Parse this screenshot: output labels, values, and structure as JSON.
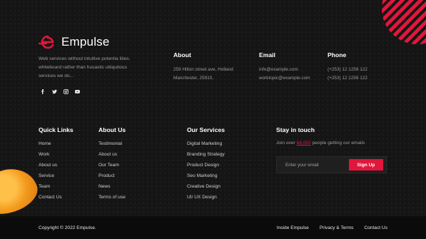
{
  "brand": {
    "name": "Empulse",
    "description": "Web services without intuitive potentia lities. whiteboard rather than husastic ubiquitous services we do...",
    "accent_color": "#e2163b"
  },
  "socials": [
    {
      "icon": "facebook-icon"
    },
    {
      "icon": "twitter-icon"
    },
    {
      "icon": "instagram-icon"
    },
    {
      "icon": "youtube-icon"
    }
  ],
  "about": {
    "title": "About",
    "line1": "259 Hilton street ave, Holland",
    "line2": "Manchester, 25910,"
  },
  "email": {
    "title": "Email",
    "line1": "info@example.com",
    "line2": "worktopic@example.com"
  },
  "phone": {
    "title": "Phone",
    "line1": "(+253) 12 1256 122",
    "line2": "(+253) 12 1256 122"
  },
  "quick_links": {
    "title": "Quick Links",
    "items": [
      "Home",
      "Work",
      "About us",
      "Service",
      "Team",
      "Contact Us"
    ]
  },
  "about_us": {
    "title": "About Us",
    "items": [
      "Testimonial",
      "About us",
      "Our Team",
      "Product",
      "News",
      "Terms of use"
    ]
  },
  "services": {
    "title": "Our Services",
    "items": [
      "Digital Marketing",
      "Branding Strategy",
      "Product Design",
      "Seo Marketing",
      "Creative Design",
      "UI/ UX Design"
    ]
  },
  "stay": {
    "title": "Stay in touch",
    "text_before": "Join over ",
    "highlight": "68,000",
    "text_after": " people getting our emails",
    "email_placeholder": "Enter your email",
    "button_label": "Sign Up"
  },
  "bottom": {
    "copyright": "Copyright © 2022 Empulse.",
    "links": [
      "Inside Empulse",
      "Privacy & Terms",
      "Contact Us"
    ]
  }
}
